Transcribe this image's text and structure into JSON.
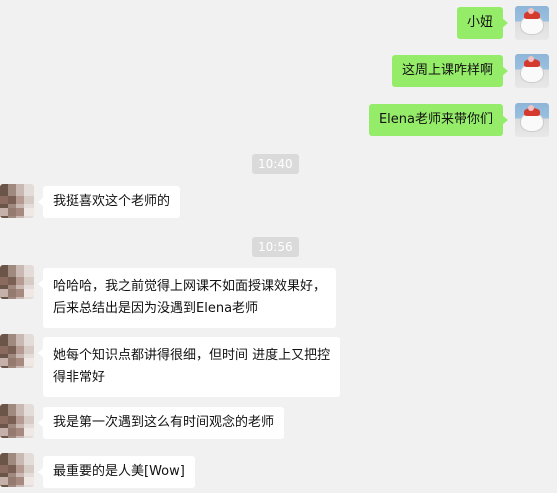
{
  "messages": [
    {
      "sender": "self",
      "text": "小妞"
    },
    {
      "sender": "self",
      "text": "这周上课咋样啊"
    },
    {
      "sender": "self",
      "text": "Elena老师来带你们"
    },
    {
      "timestamp": "10:40"
    },
    {
      "sender": "other",
      "text": "我挺喜欢这个老师的"
    },
    {
      "timestamp": "10:56"
    },
    {
      "sender": "other",
      "lines": [
        "哈哈哈，我之前觉得上网课不如面授课效果好，",
        "后来总结出是因为没遇到Elena老师"
      ]
    },
    {
      "sender": "other",
      "lines": [
        "她每个知识点都讲得很细，但时间 进度上又把控",
        "得非常好"
      ]
    },
    {
      "sender": "other",
      "text": "我是第一次遇到这么有时间观念的老师"
    },
    {
      "sender": "other",
      "text": "最重要的是人美[Wow]"
    }
  ],
  "colors": {
    "self_bubble": "#95ec69",
    "other_bubble": "#ffffff",
    "background": "#f1f1f1",
    "timestamp_bg": "#dadada"
  }
}
